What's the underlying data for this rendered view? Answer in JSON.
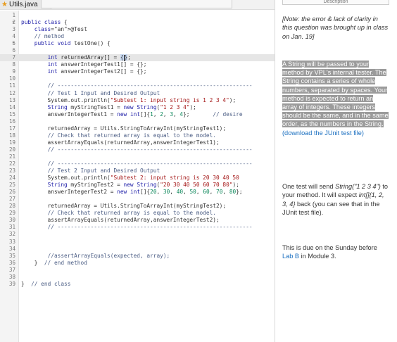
{
  "tab": {
    "title": "Utils.java"
  },
  "panel": {
    "header": "Description"
  },
  "code_lines": [
    {
      "n": "1",
      "t": ""
    },
    {
      "n": "2",
      "t": "public class {",
      "fold": true
    },
    {
      "n": "3",
      "t": "    @Test"
    },
    {
      "n": "4",
      "t": "    // method"
    },
    {
      "n": "5",
      "t": "    public void testOne() {",
      "fold": true
    },
    {
      "n": "6",
      "t": ""
    },
    {
      "n": "7",
      "t": "        int returnedArray[] = {};",
      "hl": true
    },
    {
      "n": "8",
      "t": "        int answerIntegerTest1[] = {};"
    },
    {
      "n": "9",
      "t": "        int answerIntegerTest2[] = {};"
    },
    {
      "n": "10",
      "t": ""
    },
    {
      "n": "11",
      "t": "        // -----------------------------------------------------------"
    },
    {
      "n": "12",
      "t": "        // Test 1 Input and Desired Output"
    },
    {
      "n": "13",
      "t": "        System.out.println(\"Subtest 1: input string is 1 2 3 4\");"
    },
    {
      "n": "14",
      "t": "        String myStringTest1 = new String(\"1 2 3 4\");"
    },
    {
      "n": "15",
      "t": "        answerIntegerTest1 = new int[]{1, 2, 3, 4};       // desire"
    },
    {
      "n": "16",
      "t": ""
    },
    {
      "n": "17",
      "t": "        returnedArray = Utils.StringToArrayInt(myStringTest1);"
    },
    {
      "n": "18",
      "t": "        // Check that returned array is equal to the model."
    },
    {
      "n": "19",
      "t": "        assertArrayEquals(returnedArray,answerIntegerTest1);"
    },
    {
      "n": "20",
      "t": "        // -----------------------------------------------------------"
    },
    {
      "n": "21",
      "t": ""
    },
    {
      "n": "22",
      "t": "        // -----------------------------------------------------------"
    },
    {
      "n": "23",
      "t": "        // Test 2 Input and Desired Output"
    },
    {
      "n": "24",
      "t": "        System.out.println(\"Subtest 2: input string is 20 30 40 50"
    },
    {
      "n": "25",
      "t": "        String myStringTest2 = new String(\"20 30 40 50 60 70 80\");"
    },
    {
      "n": "26",
      "t": "        answerIntegerTest2 = new int[]{20, 30, 40, 50, 60, 70, 80};"
    },
    {
      "n": "27",
      "t": ""
    },
    {
      "n": "28",
      "t": "        returnedArray = Utils.StringToArrayInt(myStringTest2);"
    },
    {
      "n": "29",
      "t": "        // Check that returned array is equal to the model."
    },
    {
      "n": "30",
      "t": "        assertArrayEquals(returnedArray,answerIntegerTest2);"
    },
    {
      "n": "31",
      "t": "        // -----------------------------------------------------------"
    },
    {
      "n": "32",
      "t": ""
    },
    {
      "n": "33",
      "t": ""
    },
    {
      "n": "34",
      "t": ""
    },
    {
      "n": "35",
      "t": "        //assertArrayEquals(expected, array);"
    },
    {
      "n": "36",
      "t": "    }  // end method"
    },
    {
      "n": "37",
      "t": ""
    },
    {
      "n": "38",
      "t": ""
    },
    {
      "n": "39",
      "t": "}  // end class"
    }
  ],
  "description": {
    "note": "[Note: the error & lack of clarity in this question was brought up in class on Jan. 19]",
    "main_highlight": "A String will be passed to your method by VPL's internal tester.  The String contains a series of whole numbers, separated by spaces.  Your method is expected to return an array of integers.  These integers should be the same, and in the same order, as the numbers in the String.",
    "main_link": "(download the JUnit test file)",
    "p2_a": "One test will send ",
    "p2_b": "String(\"1 2 3 4\")",
    "p2_c": " to your method.  It will expect ",
    "p2_d": "int[]{1, 2, 3, 4}",
    "p2_e": " back (you can see that in the JUnit test file).",
    "p3_a": "This is due on the Sunday before ",
    "p3_link": "Lab B",
    "p3_b": " in Module 3."
  }
}
